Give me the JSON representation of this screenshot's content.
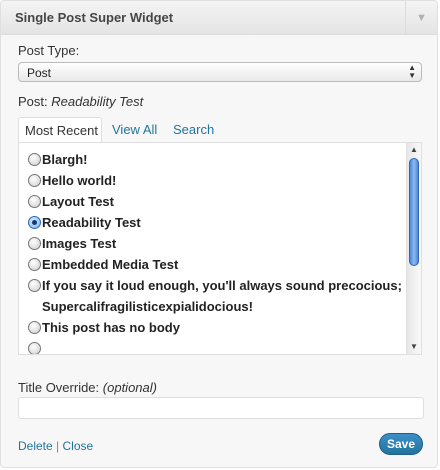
{
  "widget": {
    "title": "Single Post Super Widget",
    "toggle_icon": "▼"
  },
  "post_type": {
    "label": "Post Type:",
    "selected": "Post",
    "arrows_icon": "▲▼"
  },
  "post": {
    "label": "Post:",
    "value": "Readability Test"
  },
  "tabs": [
    {
      "label": "Most Recent",
      "active": true
    },
    {
      "label": "View All",
      "active": false
    },
    {
      "label": "Search",
      "active": false
    }
  ],
  "posts": [
    {
      "title": "Blargh!",
      "checked": false
    },
    {
      "title": "Hello world!",
      "checked": false
    },
    {
      "title": "Layout Test",
      "checked": false
    },
    {
      "title": "Readability Test",
      "checked": true
    },
    {
      "title": "Images Test",
      "checked": false
    },
    {
      "title": "Embedded Media Test",
      "checked": false
    },
    {
      "title": "If you say it loud enough, you'll always sound precocious; Supercalifragilisticexpialidocious!",
      "checked": false
    },
    {
      "title": "This post has no body",
      "checked": false
    },
    {
      "title": "",
      "checked": false
    }
  ],
  "scrollbar": {
    "up_icon": "▲",
    "down_icon": "▼"
  },
  "title_override": {
    "label": "Title Override:",
    "hint": "(optional)",
    "value": ""
  },
  "footer": {
    "delete": "Delete",
    "separator": "|",
    "close": "Close",
    "save": "Save"
  }
}
